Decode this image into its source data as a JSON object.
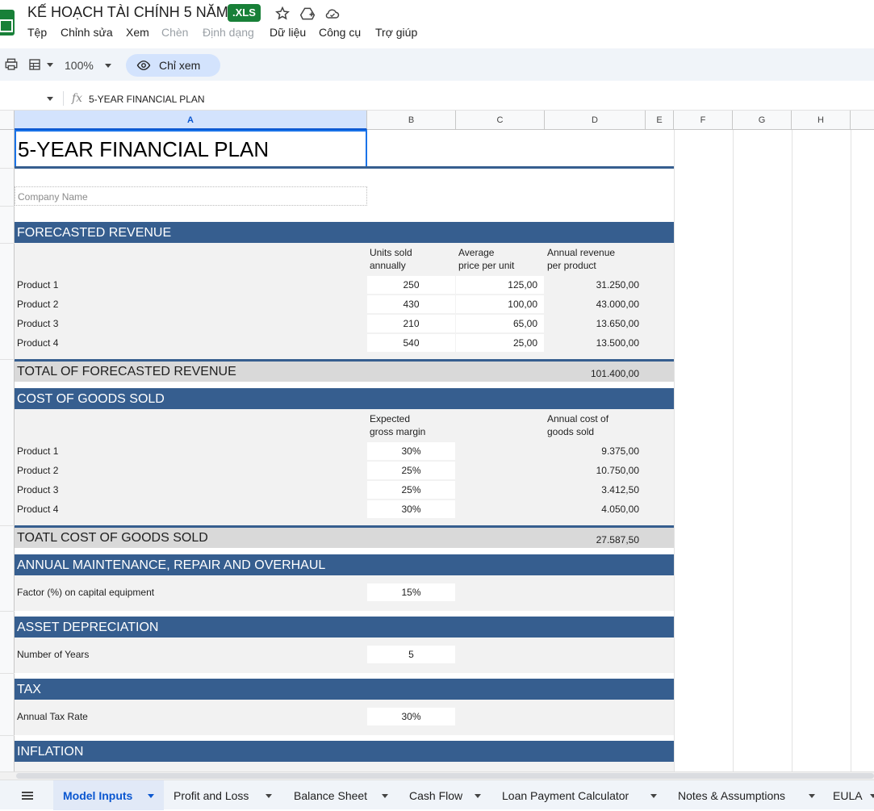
{
  "app": {
    "title": "KẾ HOẠCH TÀI CHÍNH 5 NĂM",
    "badge": ".XLS",
    "menu": [
      "Tệp",
      "Chỉnh sửa",
      "Xem",
      "Chèn",
      "Định dạng",
      "Dữ liệu",
      "Công cụ",
      "Trợ giúp"
    ],
    "menu_disabled": [
      "Chèn",
      "Định dạng"
    ]
  },
  "toolbar": {
    "zoom": "100%",
    "view_only": "Chỉ xem"
  },
  "formula_bar": {
    "fx": "fx",
    "value": "5-YEAR FINANCIAL PLAN"
  },
  "columns": [
    "A",
    "B",
    "C",
    "D",
    "E",
    "F",
    "G",
    "H"
  ],
  "sheet": {
    "title": "5-YEAR FINANCIAL PLAN",
    "company_placeholder": "Company Name",
    "revenue": {
      "header": "FORECASTED REVENUE",
      "col_units": "Units sold\nannually",
      "col_price": "Average\nprice per unit",
      "col_annual": "Annual revenue\nper product",
      "rows": [
        {
          "name": "Product 1",
          "units": "250",
          "price": "125,00",
          "annual": "31.250,00"
        },
        {
          "name": "Product 2",
          "units": "430",
          "price": "100,00",
          "annual": "43.000,00"
        },
        {
          "name": "Product 3",
          "units": "210",
          "price": "65,00",
          "annual": "13.650,00"
        },
        {
          "name": "Product 4",
          "units": "540",
          "price": "25,00",
          "annual": "13.500,00"
        }
      ],
      "total_label": "TOTAL OF FORECASTED REVENUE",
      "total_value": "101.400,00"
    },
    "cogs": {
      "header": "COST OF GOODS SOLD",
      "col_margin": "Expected\ngross margin",
      "col_cost": "Annual cost of\ngoods sold",
      "rows": [
        {
          "name": "Product 1",
          "margin": "30%",
          "cost": "9.375,00"
        },
        {
          "name": "Product 2",
          "margin": "25%",
          "cost": "10.750,00"
        },
        {
          "name": "Product 3",
          "margin": "25%",
          "cost": "3.412,50"
        },
        {
          "name": "Product 4",
          "margin": "30%",
          "cost": "4.050,00"
        }
      ],
      "total_label": "TOATL COST OF GOODS SOLD",
      "total_value": "27.587,50"
    },
    "maintenance": {
      "header": "ANNUAL MAINTENANCE, REPAIR AND OVERHAUL",
      "label": "Factor (%) on capital equipment",
      "value": "15%"
    },
    "depreciation": {
      "header": "ASSET DEPRECIATION",
      "label": "Number of Years",
      "value": "5"
    },
    "tax": {
      "header": "TAX",
      "label": "Annual Tax Rate",
      "value": "30%"
    },
    "inflation": {
      "header": "INFLATION"
    }
  },
  "tabs": [
    {
      "label": "Model Inputs",
      "active": true
    },
    {
      "label": "Profit and Loss"
    },
    {
      "label": "Balance Sheet"
    },
    {
      "label": "Cash Flow"
    },
    {
      "label": "Loan Payment Calculator"
    },
    {
      "label": "Notes & Assumptions"
    },
    {
      "label": "EULA"
    }
  ],
  "colors": {
    "band": "#365e8f",
    "accent": "#188038",
    "selection": "#0b57d0"
  }
}
